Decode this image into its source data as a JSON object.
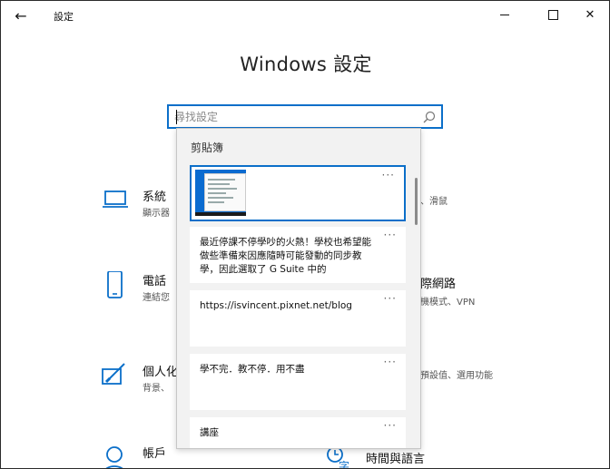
{
  "window": {
    "title": "設定",
    "back_icon": "←",
    "close_icon": "✕"
  },
  "page": {
    "title": "Windows 設定"
  },
  "search": {
    "placeholder": "尋找設定"
  },
  "tiles_left": [
    {
      "title": "系統",
      "subtitle": "顯示器",
      "icon": "laptop-icon"
    },
    {
      "title": "電話",
      "subtitle": "連結您",
      "icon": "phone-icon"
    },
    {
      "title": "個人化",
      "subtitle": "背景、",
      "icon": "personalization-icon"
    },
    {
      "title": "帳戶",
      "subtitle": "",
      "icon": "account-icon"
    }
  ],
  "tiles_right": [
    {
      "title": "",
      "subtitle": "、滑鼠"
    },
    {
      "title": "際網路",
      "subtitle": "機模式、VPN"
    },
    {
      "title": "",
      "subtitle": "預設值、選用功能"
    },
    {
      "title": "時間與語言",
      "subtitle": "",
      "icon": "time-language-icon"
    }
  ],
  "clipboard": {
    "header": "剪貼簿",
    "more_icon": "···",
    "items": [
      {
        "type": "image",
        "text": ""
      },
      {
        "type": "text",
        "text": "最近停課不停學吵的火熱！學校也希望能做些準備來因應隨時可能發動的同步教學，因此選取了 G Suite 中的"
      },
      {
        "type": "text",
        "text": "https://isvincent.pixnet.net/blog"
      },
      {
        "type": "text",
        "text": "學不完．教不停．用不盡"
      },
      {
        "type": "text",
        "text": "講座"
      }
    ]
  },
  "colors": {
    "accent": "#0b6fc9",
    "panel_bg": "#f2f2f2"
  }
}
